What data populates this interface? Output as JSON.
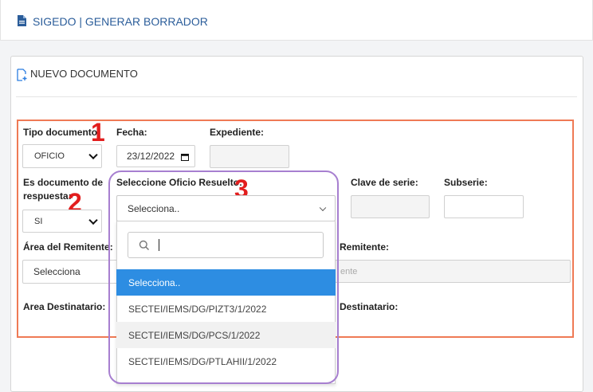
{
  "header": {
    "title": "SIGEDO | GENERAR BORRADOR"
  },
  "card": {
    "title": "NUEVO DOCUMENTO"
  },
  "annotations": {
    "n1": "1",
    "n2": "2",
    "n3": "3"
  },
  "form": {
    "tipo_documento": {
      "label": "Tipo documento:",
      "value": "OFICIO"
    },
    "fecha": {
      "label": "Fecha:",
      "value": "23/12/2022"
    },
    "expediente": {
      "label": "Expediente:",
      "value": ""
    },
    "es_respuesta": {
      "label_line1": "Es documento de",
      "label_line2": "respuesta:",
      "value": "SI"
    },
    "oficio_resuelto": {
      "label": "Seleccione Oficio Resuelto:",
      "value": "Selecciona.."
    },
    "clave_serie": {
      "label": "Clave de serie:",
      "value": ""
    },
    "subserie": {
      "label": "Subserie:",
      "value": ""
    },
    "area_remitente": {
      "label": "Área del Remitente:",
      "value": "Selecciona"
    },
    "remitente": {
      "label": "Remitente:",
      "placeholder_fragment": "ente"
    },
    "area_destinatario": {
      "label": "Area Destinatario:"
    },
    "destinatario": {
      "label": "Destinatario:"
    }
  },
  "dropdown": {
    "search_value": "",
    "options": [
      "Selecciona..",
      "SECTEI/IEMS/DG/PIZT3/1/2022",
      "SECTEI/IEMS/DG/PCS/1/2022",
      "SECTEI/IEMS/DG/PTLAHII/1/2022"
    ],
    "selected_index": 0,
    "hover_index": 2
  },
  "colors": {
    "accent": "#2b5d9a",
    "orange_box": "#ef7a55",
    "purple_box": "#a77fd0",
    "option_selected": "#2d8de2",
    "annotation": "#e21d1d"
  }
}
